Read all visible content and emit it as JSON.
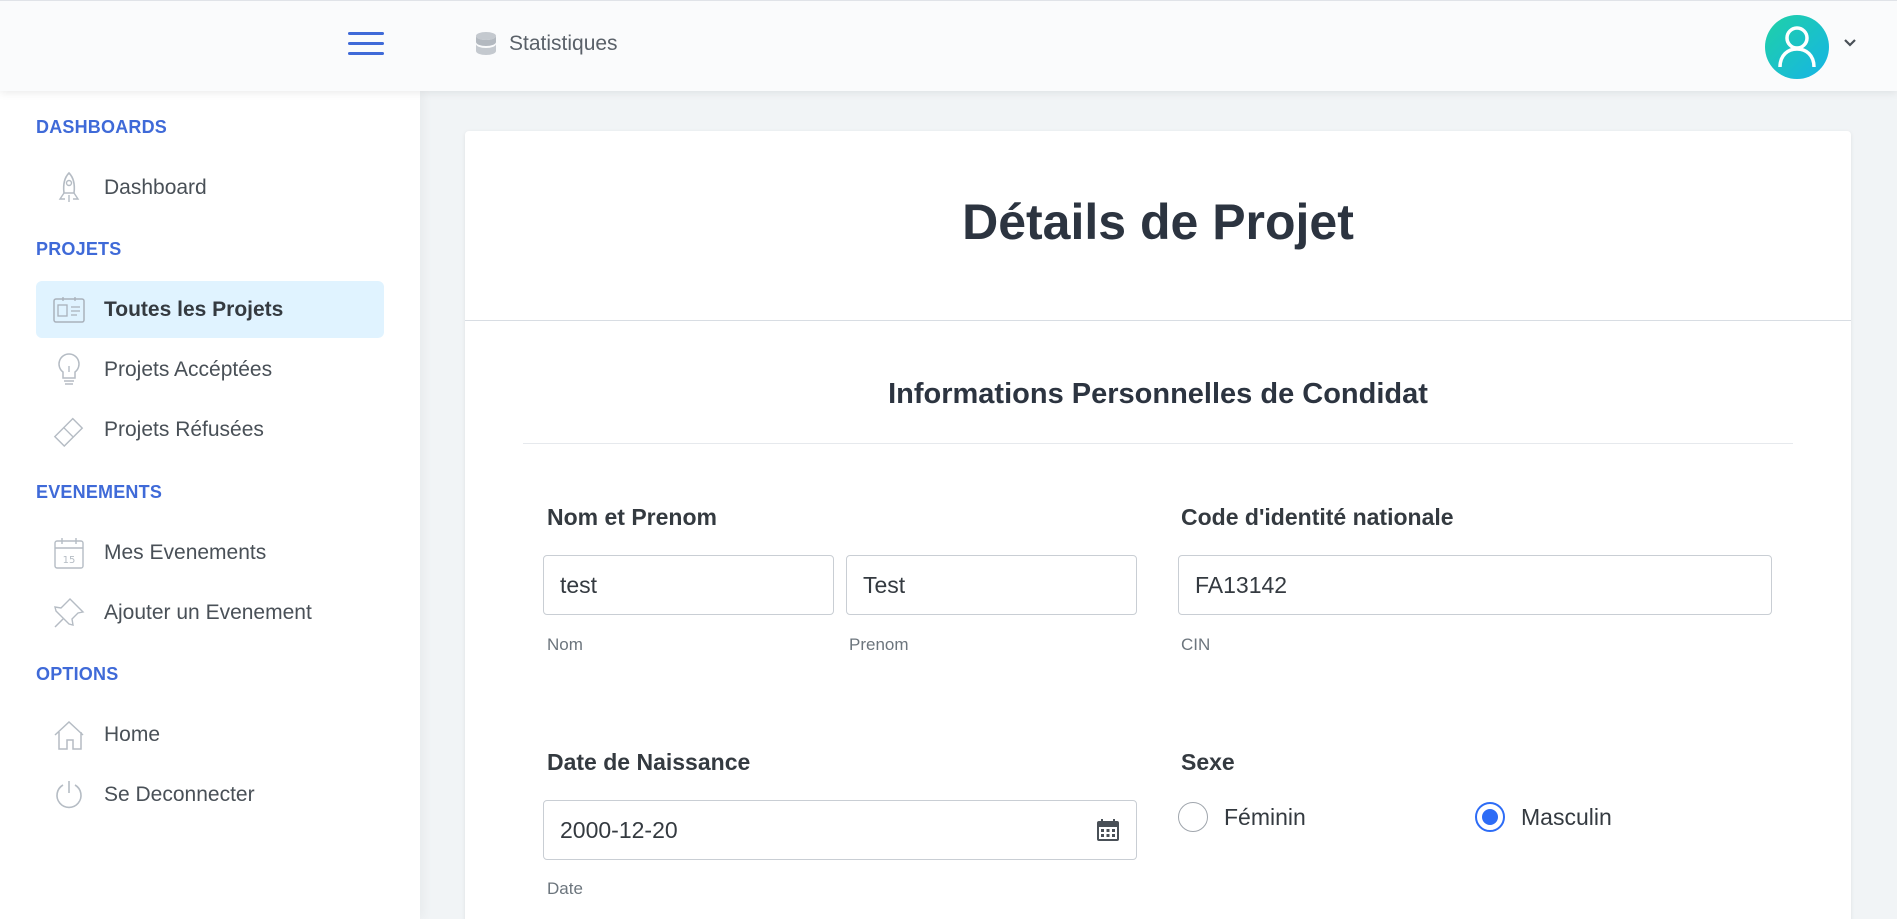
{
  "header": {
    "stats_label": "Statistiques"
  },
  "sidebar": {
    "sections": [
      {
        "title": "DASHBOARDS"
      },
      {
        "title": "PROJETS"
      },
      {
        "title": "EVENEMENTS"
      },
      {
        "title": "OPTIONS"
      }
    ],
    "items": [
      {
        "label": "Dashboard",
        "icon": "rocket-icon"
      },
      {
        "label": "Toutes les Projets",
        "icon": "id-card-icon",
        "active": true
      },
      {
        "label": "Projets Accéptées",
        "icon": "lightbulb-icon"
      },
      {
        "label": "Projets Réfusées",
        "icon": "eraser-icon"
      },
      {
        "label": "Mes Evenements",
        "icon": "calendar-icon",
        "calendar_day": "15"
      },
      {
        "label": "Ajouter un Evenement",
        "icon": "pin-icon"
      },
      {
        "label": "Home",
        "icon": "home-icon"
      },
      {
        "label": "Se Deconnecter",
        "icon": "power-icon"
      }
    ]
  },
  "main": {
    "title": "Détails de Projet",
    "section_title": "Informations Personnelles de Condidat",
    "nom_prenom": {
      "label": "Nom et Prenom",
      "nom_value": "test",
      "nom_help": "Nom",
      "prenom_value": "Test",
      "prenom_help": "Prenom"
    },
    "cin": {
      "label": "Code d'identité nationale",
      "value": "FA13142",
      "help": "CIN"
    },
    "date_naissance": {
      "label": "Date de Naissance",
      "value": "2000-12-20",
      "help": "Date"
    },
    "sexe": {
      "label": "Sexe",
      "options": [
        {
          "label": "Féminin",
          "checked": false
        },
        {
          "label": "Masculin",
          "checked": true
        }
      ]
    }
  },
  "colors": {
    "accent": "#3f6ad8",
    "active_bg": "#e0f3ff",
    "radio": "#2d6cf6"
  }
}
